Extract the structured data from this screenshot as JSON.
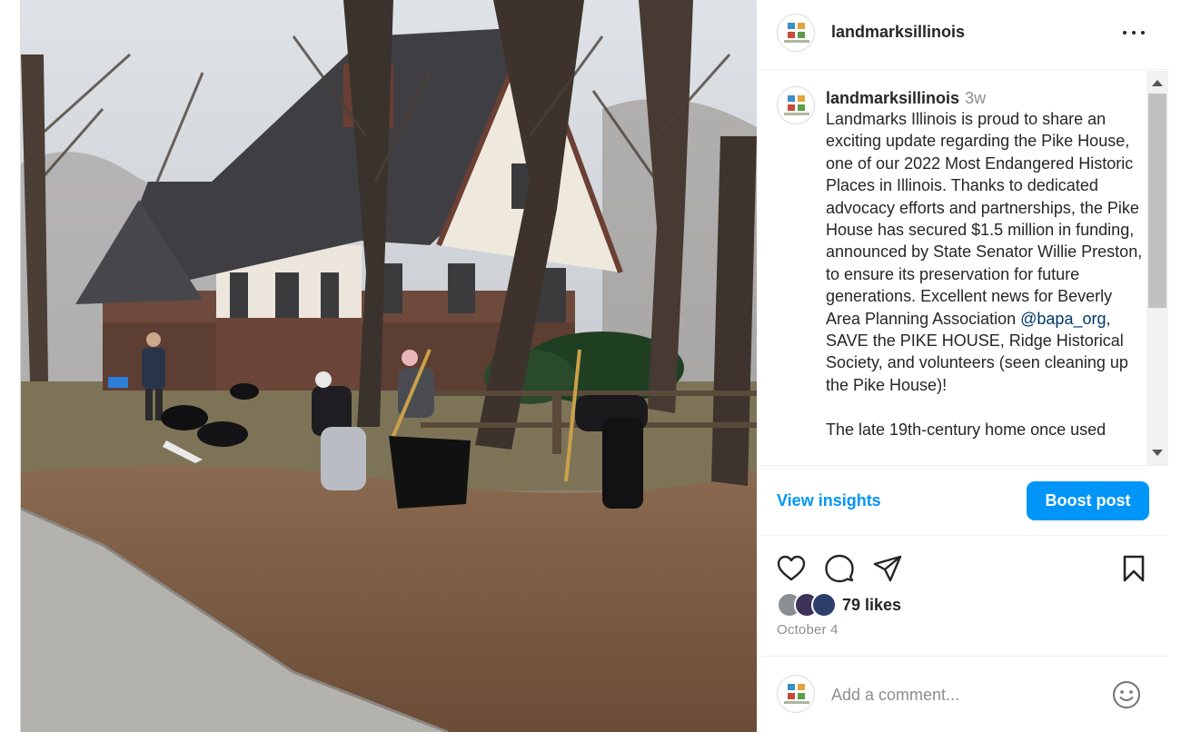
{
  "photo": {
    "alt_icon": "photo-of-house"
  },
  "header": {
    "username": "landmarksillinois",
    "more_icon": "more-horizontal-icon"
  },
  "caption": {
    "username": "landmarksillinois",
    "time_ago": "3w",
    "paragraphs": [
      [
        "Landmarks Illinois is proud to share an exciting update regarding the Pike House, one of our 2022 Most Endangered Historic Places in Illinois. Thanks to dedicated advocacy efforts and partnerships, the Pike House has secured $1.5 million in funding, announced by State Senator Willie Preston, to ensure its preservation for future generations. Excellent news for Beverly Area Planning Association ",
        "@bapa_org",
        ", SAVE the PIKE HOUSE, Ridge Historical Society, and volunteers (seen cleaning up the Pike House)!"
      ],
      [
        "The late 19th-century home once used"
      ]
    ]
  },
  "insights": {
    "view_label": "View insights",
    "boost_label": "Boost post"
  },
  "actions": {
    "like_icon": "heart-icon",
    "comment_icon": "comment-icon",
    "share_icon": "share-icon",
    "save_icon": "bookmark-icon"
  },
  "likes": {
    "count_label": "79 likes"
  },
  "date": "October 4",
  "comment": {
    "placeholder": "Add a comment...",
    "emoji_icon": "emoji-icon"
  },
  "colors": {
    "accent": "#0095f6",
    "mention": "#00376b",
    "muted": "#8e8e8e"
  }
}
